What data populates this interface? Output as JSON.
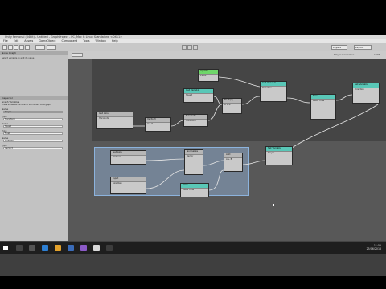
{
  "window": {
    "title": "Unity Personal (64bit) - Untitled - GraphProject - PC, Mac & Linux Standalone <DX11>"
  },
  "menu": [
    "File",
    "Edit",
    "Assets",
    "GameObject",
    "Component",
    "Tools",
    "Window",
    "Help"
  ],
  "toolbar": {
    "layers_label": "Layers",
    "layout_label": "Layout"
  },
  "left_panel": {
    "tab_a": "Node Graph",
    "tab_b": "Inspector",
    "hint": "Select variable to edit its value",
    "props_header": "Graph Variables",
    "props_note": "These variables are local to the current node graph",
    "rows": [
      {
        "name": "Name",
        "value": "Player"
      },
      {
        "name": "Type",
        "value": "Transform"
      },
      {
        "name": "Name",
        "value": "Speed"
      },
      {
        "name": "Type",
        "value": "Float"
      },
      {
        "name": "Name",
        "value": "Direction"
      },
      {
        "name": "Type",
        "value": "Vector3"
      }
    ]
  },
  "graph": {
    "breadcrumb": "Player Controller",
    "zoom": "100%",
    "nodes": [
      {
        "id": "n1",
        "title": "Update",
        "sub": "Event",
        "style": "green"
      },
      {
        "id": "n2",
        "title": "Get Variable",
        "sub": "Speed",
        "style": "teal"
      },
      {
        "id": "n3",
        "title": "Multiply",
        "sub": "A × B",
        "style": "plain"
      },
      {
        "id": "n4",
        "title": "Get Variable",
        "sub": "Direction",
        "style": "teal"
      },
      {
        "id": "n5",
        "title": "Get Axis",
        "sub": "Horizontal",
        "style": "plain"
      },
      {
        "id": "n6",
        "title": "Vector3",
        "sub": "X Y Z",
        "style": "plain"
      },
      {
        "id": "n7",
        "title": "Translate",
        "sub": "Transform",
        "style": "plain"
      },
      {
        "id": "n8",
        "title": "Time",
        "sub": "Delta Time",
        "style": "teal"
      },
      {
        "id": "n9",
        "title": "Set Variable",
        "sub": "Direction",
        "style": "teal"
      },
      {
        "id": "n10",
        "title": "Get Axis",
        "sub": "Vertical",
        "style": "plain"
      },
      {
        "id": "n11",
        "title": "Normalize",
        "sub": "Vector",
        "style": "plain"
      },
      {
        "id": "n12",
        "title": "Input",
        "sub": "Axis Raw",
        "style": "plain"
      },
      {
        "id": "n13",
        "title": "Add",
        "sub": "A + B",
        "style": "plain"
      },
      {
        "id": "n14",
        "title": "Set Variable",
        "sub": "Player",
        "style": "teal"
      }
    ]
  },
  "taskbar": {
    "time": "11:52",
    "date": "25/06/2016"
  }
}
